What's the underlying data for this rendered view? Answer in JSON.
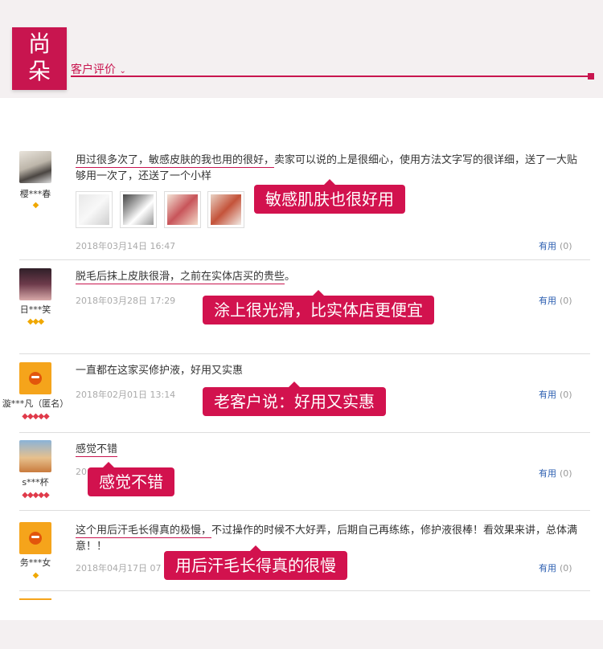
{
  "brand": {
    "logo_line1": "尚",
    "logo_line2": "朵"
  },
  "section": {
    "label": "客户评价",
    "chevron": "chevron-down-icon"
  },
  "reviews": [
    {
      "nickname": "樱***春",
      "badge": "◆",
      "text_underlined": "用过很多次了，敏感皮肤的我也用的很好，",
      "text_rest": "卖家可以说的上是很细心，使用方法文字写的很详细，送了一大贴够用一次了，还送了一个小样",
      "date": "2018年03月14日 16:47",
      "useful_label": "有用",
      "useful_count": "(0)",
      "callout": "敏感肌肤也很好用"
    },
    {
      "nickname": "日***笑",
      "badge": "◆◆◆",
      "text_underlined": "脱毛后抹上皮肤很滑，之前在实体店买的贵些",
      "text_rest": "。",
      "date": "2018年03月28日 17:29",
      "useful_label": "有用",
      "useful_count": "(0)",
      "callout": "涂上很光滑，比实体店更便宜"
    },
    {
      "nickname": "漩***凡（匿名）",
      "badge": "◆◆◆◆◆",
      "text_underlined": "",
      "text_rest": "一直都在这家买修护液，好用又实惠",
      "date": "2018年02月01日 13:14",
      "useful_label": "有用",
      "useful_count": "(0)",
      "callout": "老客户说：好用又实惠"
    },
    {
      "nickname": "s***杯",
      "badge": "◆◆◆◆◆",
      "text_underlined": "感觉不错",
      "text_rest": "",
      "date": "20",
      "useful_label": "有用",
      "useful_count": "(0)",
      "callout": "感觉不错"
    },
    {
      "nickname": "务***女",
      "badge": "◆",
      "text_underlined": "这个用后汗毛长得真的极慢，",
      "text_rest": "不过操作的时候不大好弄，后期自己再练练，修护液很棒！看效果来讲，总体满意！！",
      "date": "2018年04月17日 07",
      "useful_label": "有用",
      "useful_count": "(0)",
      "callout": "用后汗毛长得真的很慢"
    }
  ],
  "colors": {
    "accent": "#c8154f",
    "callout": "#d2124e",
    "link": "#2a5db0"
  }
}
